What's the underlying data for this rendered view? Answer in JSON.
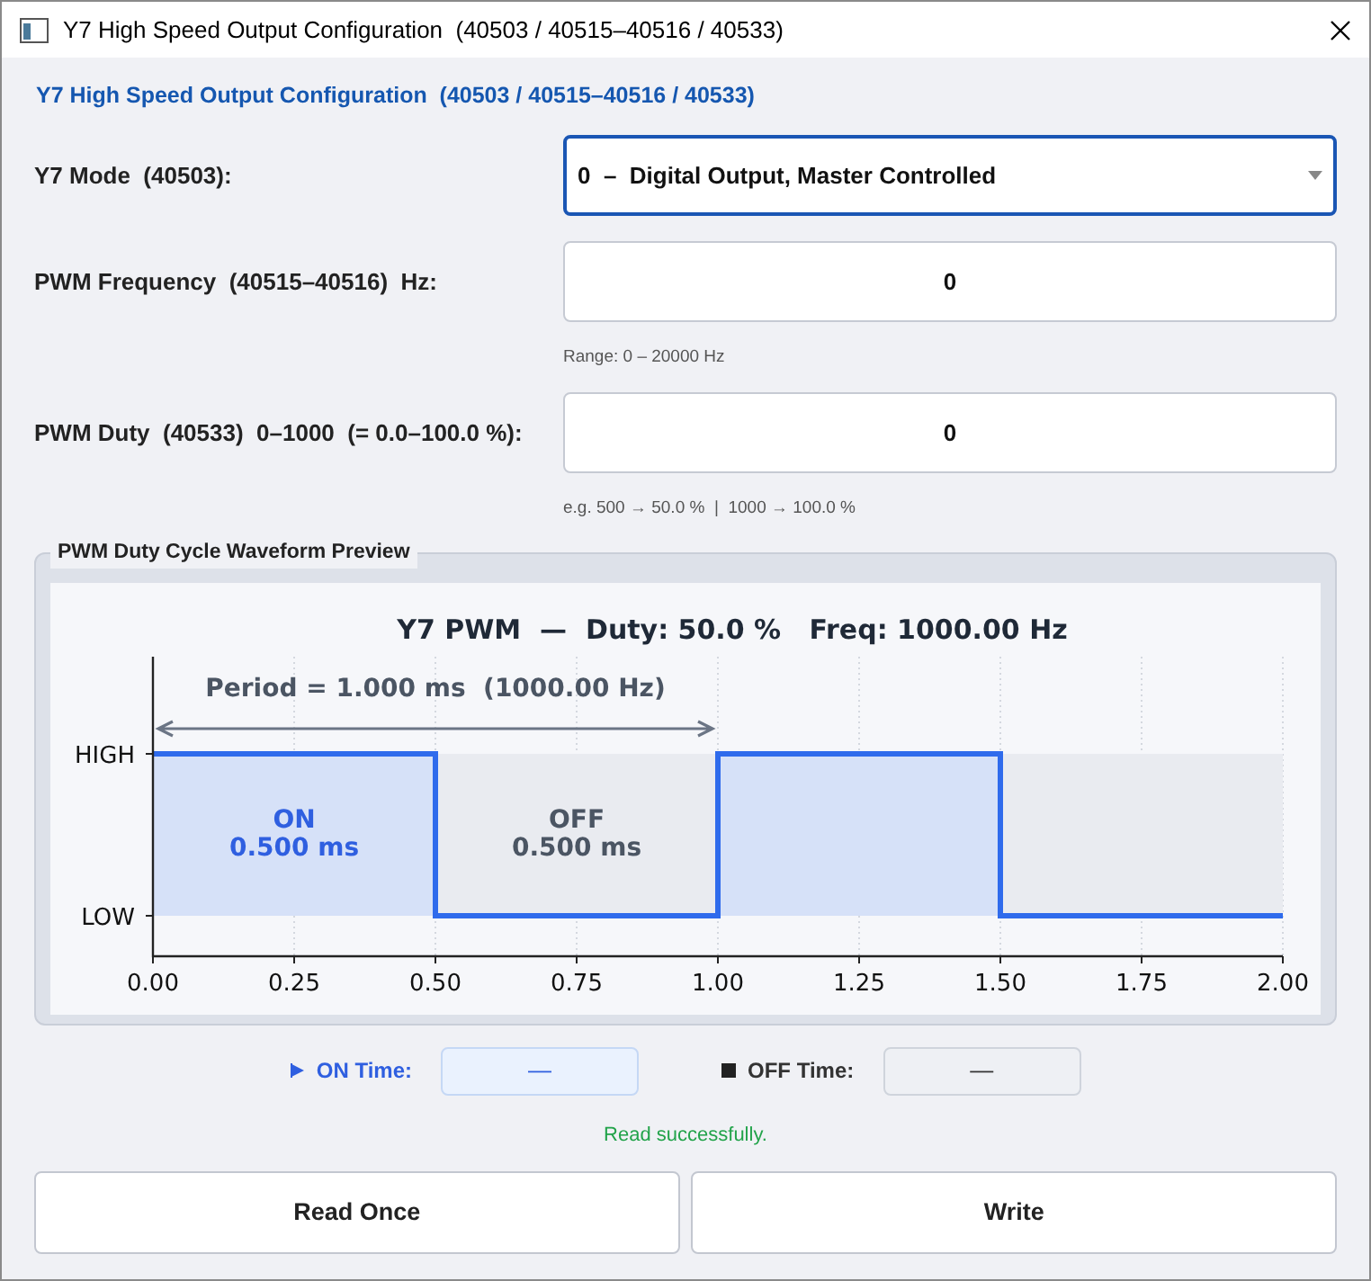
{
  "window": {
    "title": "Y7 High Speed Output Configuration  (40503 / 40515–40516 / 40533)"
  },
  "header": "Y7 High Speed Output Configuration  (40503 / 40515–40516 / 40533)",
  "fields": [
    {
      "kind": "select",
      "label": "Y7 Mode  (40503):",
      "value": "0  –  Digital Output, Master Controlled",
      "focused": true
    },
    {
      "kind": "input",
      "label": "PWM Frequency  (40515–40516)  Hz:",
      "value": "0",
      "hint": "Range: 0 – 20000 Hz",
      "focused": false
    },
    {
      "kind": "input",
      "label": "PWM Duty  (40533)  0–1000  (= 0.0–100.0 %):",
      "value": "0",
      "hint": "e.g. 500 → 50.0 %  |  1000 → 100.0 %",
      "focused": false
    }
  ],
  "preview": {
    "title": "PWM Duty Cycle Waveform Preview",
    "waveform": {
      "title": "Y7 PWM  —  Duty: 50.0 %   Freq: 1000.00 Hz",
      "period_label": "Period = 1.000 ms  (1000.00 Hz)",
      "on_label": [
        "ON",
        "0.500 ms"
      ],
      "off_label": [
        "OFF",
        "0.500 ms"
      ],
      "y_labels": [
        "HIGH",
        "LOW"
      ],
      "x_labels": [
        "0.00",
        "0.25",
        "0.50",
        "0.75",
        "1.00",
        "1.25",
        "1.50",
        "1.75",
        "2.00"
      ]
    }
  },
  "times": [
    {
      "kind": "on",
      "label": "ON Time:",
      "value": "—"
    },
    {
      "kind": "off",
      "label": "OFF Time:",
      "value": "—"
    }
  ],
  "status": "Read successfully.",
  "buttons": [
    "Read Once",
    "Write"
  ]
}
